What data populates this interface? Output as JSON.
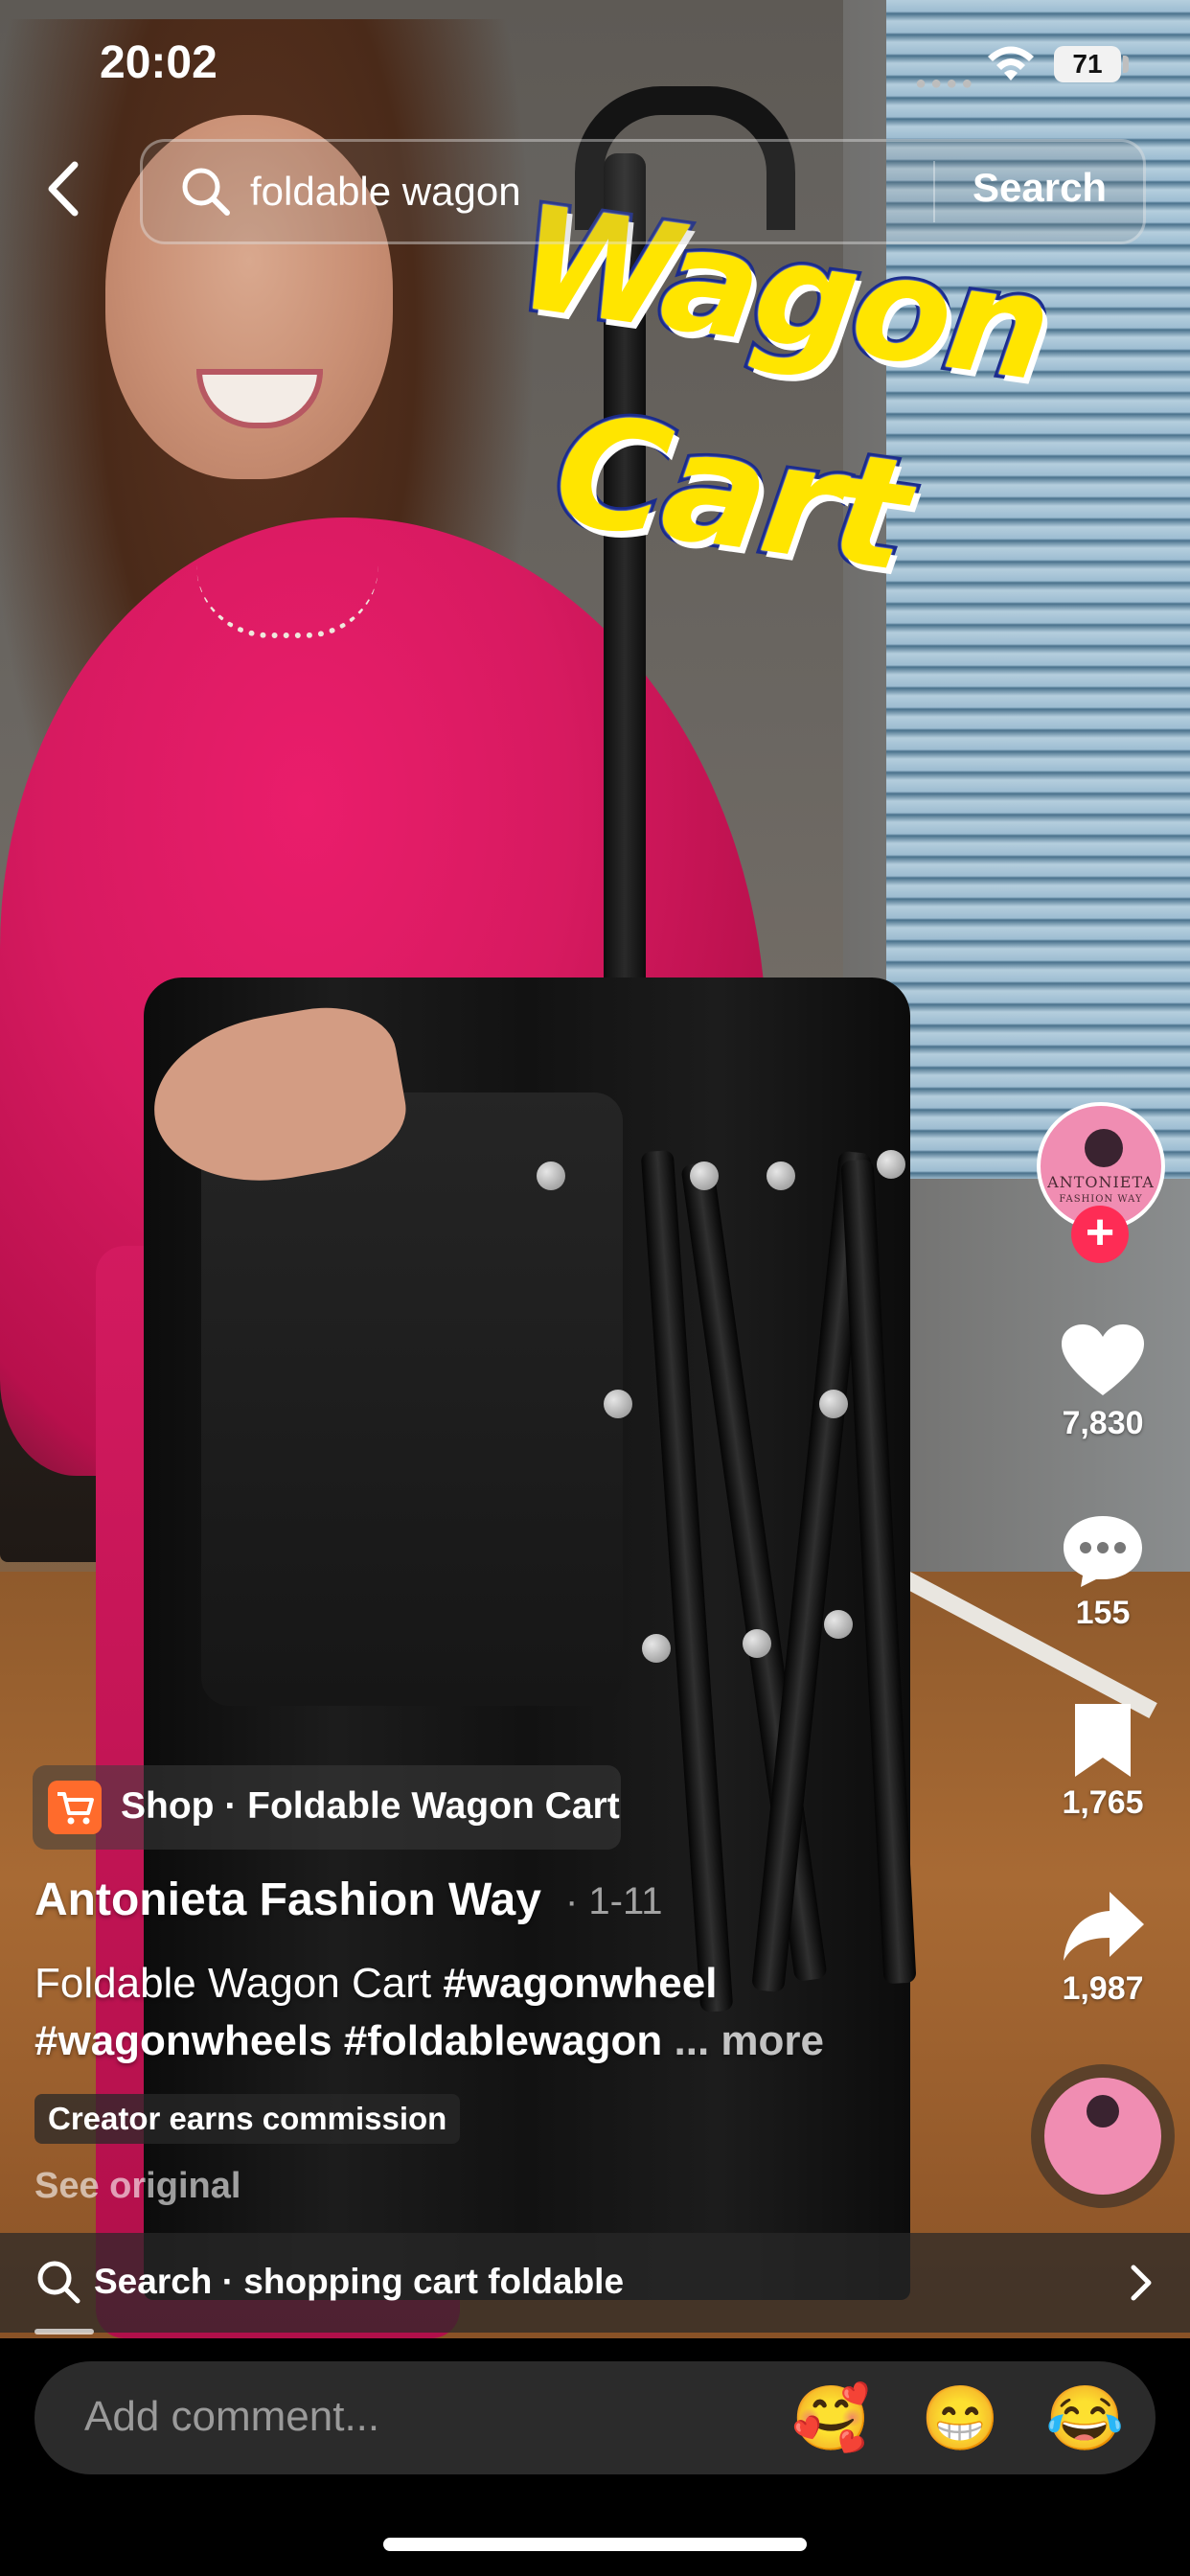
{
  "status_bar": {
    "time": "20:02",
    "battery": "71"
  },
  "search": {
    "query": "foldable wagon",
    "button_label": "Search"
  },
  "video_overlay": {
    "line1": "Wagon",
    "line2": "Cart"
  },
  "rail": {
    "likes": "7,830",
    "comments": "155",
    "saves": "1,765",
    "shares": "1,987",
    "avatar_text": "ANTONIETA",
    "avatar_subtext": "FASHION WAY",
    "follow_symbol": "+"
  },
  "post": {
    "shop_label": "Shop · Foldable Wagon Cart",
    "author": "Antonieta Fashion Way",
    "date": "· 1-11",
    "caption_text": "Foldable Wagon Cart ",
    "hashtag1": "#wagonwheel",
    "hashtag2": "#wagonwheels",
    "hashtag3": "#foldablewagon",
    "more": " ... more",
    "commission_label": "Creator earns commission",
    "see_original": "See original"
  },
  "related_search": {
    "label": "Search · shopping cart foldable"
  },
  "comment": {
    "placeholder": "Add comment...",
    "emojis": [
      "🥰",
      "😁",
      "😂"
    ]
  },
  "colors": {
    "accent": "#fe2c55",
    "shop_orange": "#ff6b2c",
    "overlay_yellow": "#ffe500",
    "overlay_outline": "#1a2b8c"
  }
}
